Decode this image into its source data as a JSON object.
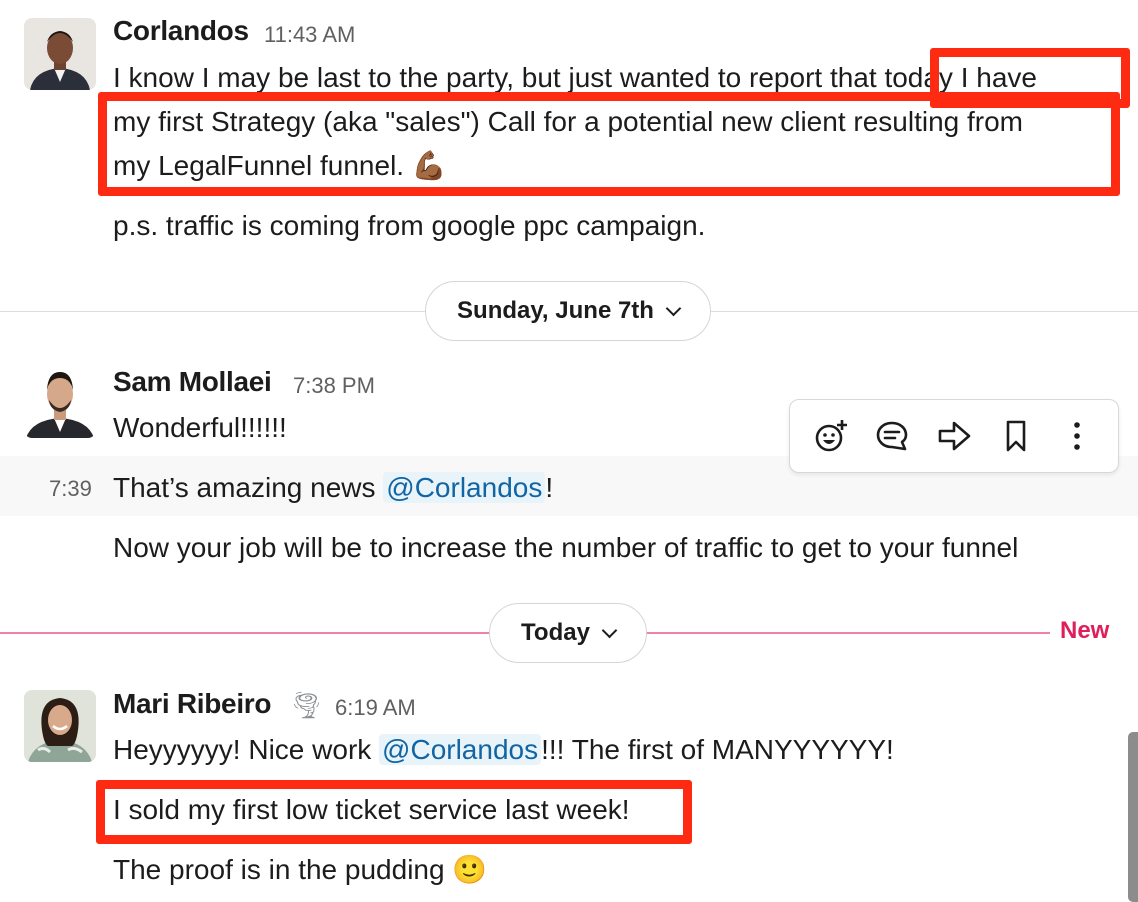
{
  "messages": {
    "corlandos": {
      "name": "Corlandos",
      "time": "11:43 AM",
      "line1_a": "I know I may be last to the party, but just wanted to report that",
      "line1_b": "today I have",
      "line2": "my first Strategy (aka \"sales\") Call for a potential new client resulting from",
      "line3": "my LegalFunnel funnel.",
      "line3_emoji": "💪🏾",
      "line4": "p.s. traffic is coming from google ppc campaign."
    },
    "sam": {
      "name": "Sam Mollaei",
      "time": "7:38 PM",
      "msg1": "Wonderful!!!!!!",
      "msg2_time": "7:39",
      "msg2_a": "That’s amazing news ",
      "msg2_mention": "@Corlandos",
      "msg2_b": "!",
      "msg3": "Now your job will be to increase the number of traffic to get to your funnel"
    },
    "mari": {
      "name": "Mari Ribeiro",
      "status_emoji": "🌪",
      "time": "6:19 AM",
      "msg1_a": "Heyyyyyy! Nice work ",
      "msg1_mention": "@Corlandos",
      "msg1_b": "!!! The first of MANYYYYYY!",
      "msg2": "I sold my first low ticket service last week!",
      "msg3": "The proof is in the pudding",
      "msg3_emoji": "🙂"
    }
  },
  "dividers": {
    "date1": "Sunday, June 7th",
    "date2": "Today",
    "new_label": "New"
  },
  "toolbar": {
    "icons": [
      "emoji-reaction-icon",
      "reply-thread-icon",
      "share-forward-icon",
      "bookmark-icon",
      "more-actions-icon"
    ]
  },
  "colors": {
    "highlight_box": "#ff2a12",
    "new_line": "#e01e5a",
    "mention_bg": "#e8f4fa",
    "mention_text": "#1264a3"
  }
}
